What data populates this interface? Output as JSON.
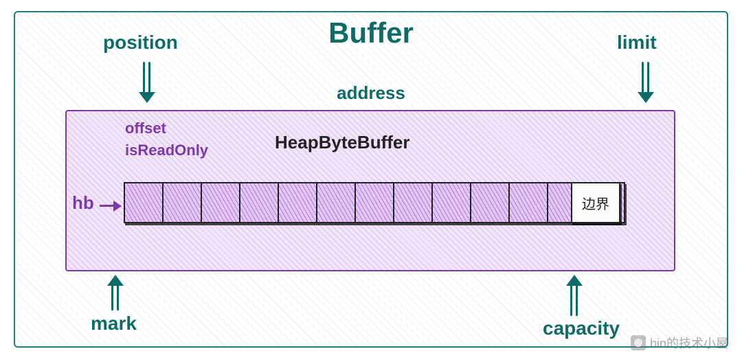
{
  "title": "Buffer",
  "address_label": "address",
  "top_labels": {
    "position": "position",
    "limit": "limit"
  },
  "bottom_labels": {
    "mark": "mark",
    "capacity": "capacity"
  },
  "inner": {
    "offset": "offset",
    "isReadOnly": "isReadOnly",
    "class_name": "HeapByteBuffer",
    "hb": "hb",
    "boundary": "边界"
  },
  "cells": {
    "count": 13
  },
  "watermark": "bin的技术小屋",
  "colors": {
    "teal": "#0f6b68",
    "purple": "#7a3aa8",
    "black": "#222222"
  }
}
